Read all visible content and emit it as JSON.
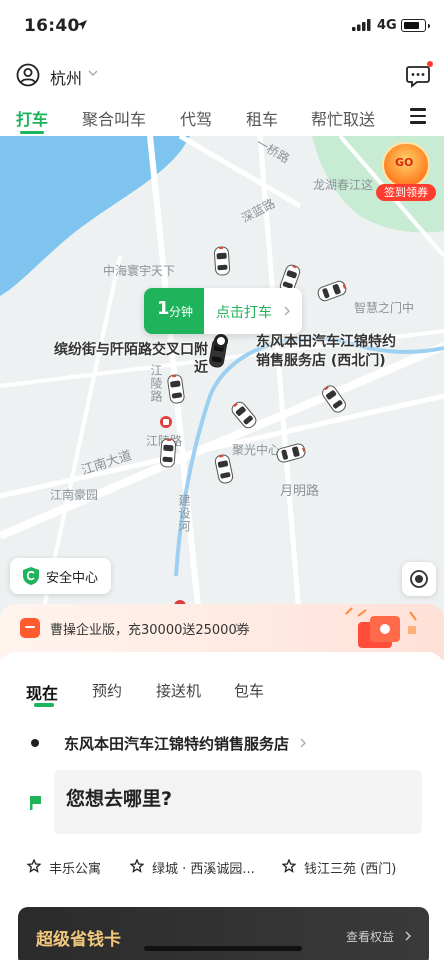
{
  "status_bar": {
    "time": "16:40",
    "network": "4G"
  },
  "header": {
    "city": "杭州"
  },
  "tabs": [
    {
      "label": "打车"
    },
    {
      "label": "聚合叫车"
    },
    {
      "label": "代驾"
    },
    {
      "label": "租车"
    },
    {
      "label": "帮忙取送"
    }
  ],
  "map": {
    "labels": {
      "road_qiao": "一桥路",
      "longhu": "龙湖春江这",
      "shenlan": "深蓝路",
      "zhonghai": "中海寰宇天下",
      "zhihui": "智慧之门中",
      "jiangling": "江陵路",
      "jiangnan": "江南大道",
      "jiangnan_yuan": "江南豪园",
      "yueming": "月明路",
      "juxian": "聚光中心",
      "jianshe": "建设河",
      "jiangling2": "江陵路",
      "zhong": "中"
    },
    "pickup_label": "缤纷街与阡陌路交叉口附近",
    "dest_label_line1": "东风本田汽车江锦特约",
    "dest_label_line2": "销售服务店 (西北门)",
    "eta": {
      "num": "1",
      "unit": "分钟",
      "action": "点击打车"
    },
    "promo_badge": {
      "go": "GO",
      "pill": "签到领券"
    },
    "safety_center": "安全中心"
  },
  "promo_strip": {
    "text": "曹操企业版，充30000送25000券"
  },
  "booking": {
    "modes": [
      {
        "label": "现在"
      },
      {
        "label": "预约"
      },
      {
        "label": "接送机"
      },
      {
        "label": "包车"
      }
    ],
    "origin": "东风本田汽车江锦特约销售服务店",
    "destination_placeholder": "您想去哪里?",
    "favorites": [
      {
        "label": "丰乐公寓"
      },
      {
        "label": "绿城 · 西溪诚园..."
      },
      {
        "label": "钱江三苑 (西门)"
      }
    ]
  },
  "saver_card": {
    "title": "超级省钱卡",
    "link": "查看权益"
  },
  "colors": {
    "brand_green": "#1fb35b",
    "promo_red": "#ff3d2e",
    "gold": "#f2c97c"
  }
}
